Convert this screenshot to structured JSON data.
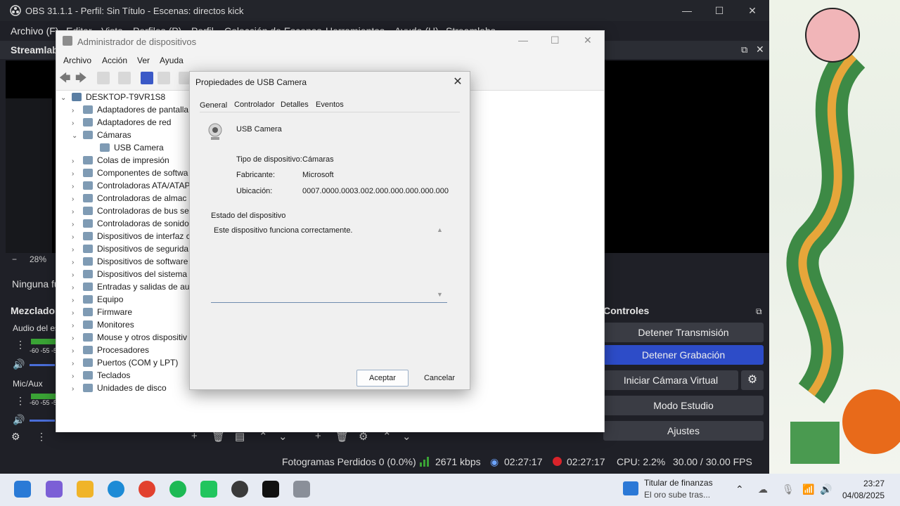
{
  "obs": {
    "title": "OBS 31.1.1 - Perfil: Sin Título - Escenas: directos kick",
    "menu": [
      "Archivo (F)",
      "Editar",
      "Vista",
      "Perfiles (P)",
      "Perfil",
      "Colección de Escenas",
      "Herramientas",
      "Ayuda (H)",
      "Streamlabs"
    ],
    "streamlabs_panel": "Streamlab",
    "zoom": "28%",
    "no_source": "Ninguna fu",
    "mixer": {
      "title": "Mezclador",
      "channel1": "Audio del es",
      "channel2": "Mic/Aux",
      "scale": "-60 -55 -5"
    },
    "controls": {
      "title": "Controles",
      "stop_stream": "Detener Transmisión",
      "stop_record": "Detener Grabación",
      "start_virtualcam": "Iniciar Cámara Virtual",
      "studio_mode": "Modo Estudio",
      "settings": "Ajustes"
    },
    "status": {
      "dropped": "Fotogramas Perdidos 0 (0.0%)",
      "bitrate": "2671 kbps",
      "stream_time": "02:27:17",
      "rec_time": "02:27:17",
      "cpu": "CPU: 2.2%",
      "fps": "30.00 / 30.00 FPS"
    }
  },
  "devmgr": {
    "title": "Administrador de dispositivos",
    "menu": [
      "Archivo",
      "Acción",
      "Ver",
      "Ayuda"
    ],
    "root": "DESKTOP-T9VR1S8",
    "tree": [
      {
        "label": "Adaptadores de pantalla",
        "chev": "›"
      },
      {
        "label": "Adaptadores de red",
        "chev": "›"
      },
      {
        "label": "Cámaras",
        "chev": "⌄"
      },
      {
        "label": "USB Camera",
        "chev": ""
      },
      {
        "label": "Colas de impresión",
        "chev": "›"
      },
      {
        "label": "Componentes de softwa",
        "chev": "›"
      },
      {
        "label": "Controladoras ATA/ATAPI",
        "chev": "›"
      },
      {
        "label": "Controladoras de almac",
        "chev": "›"
      },
      {
        "label": "Controladoras de bus se",
        "chev": "›"
      },
      {
        "label": "Controladoras de sonido",
        "chev": "›"
      },
      {
        "label": "Dispositivos de interfaz c",
        "chev": "›"
      },
      {
        "label": "Dispositivos de segurida",
        "chev": "›"
      },
      {
        "label": "Dispositivos de software",
        "chev": "›"
      },
      {
        "label": "Dispositivos del sistema",
        "chev": "›"
      },
      {
        "label": "Entradas y salidas de au",
        "chev": "›"
      },
      {
        "label": "Equipo",
        "chev": "›"
      },
      {
        "label": "Firmware",
        "chev": "›"
      },
      {
        "label": "Monitores",
        "chev": "›"
      },
      {
        "label": "Mouse y otros dispositiv",
        "chev": "›"
      },
      {
        "label": "Procesadores",
        "chev": "›"
      },
      {
        "label": "Puertos (COM y LPT)",
        "chev": "›"
      },
      {
        "label": "Teclados",
        "chev": "›"
      },
      {
        "label": "Unidades de disco",
        "chev": "›"
      }
    ]
  },
  "props": {
    "title": "Propiedades de USB Camera",
    "tabs": [
      "General",
      "Controlador",
      "Detalles",
      "Eventos"
    ],
    "device_name": "USB Camera",
    "type_label": "Tipo de dispositivo:",
    "type_value": "Cámaras",
    "maker_label": "Fabricante:",
    "maker_value": "Microsoft",
    "location_label": "Ubicación:",
    "location_value": "0007.0000.0003.002.000.000.000.000.000",
    "status_group": "Estado del dispositivo",
    "status_text": "Este dispositivo funciona correctamente.",
    "ok": "Aceptar",
    "cancel": "Cancelar"
  },
  "taskbar": {
    "news_title": "Titular de finanzas",
    "news_sub": "El oro sube tras...",
    "time": "23:27",
    "date": "04/08/2025"
  },
  "colors": {
    "accent": "#2d4cc8",
    "taskbar": "#e7ebf3"
  }
}
